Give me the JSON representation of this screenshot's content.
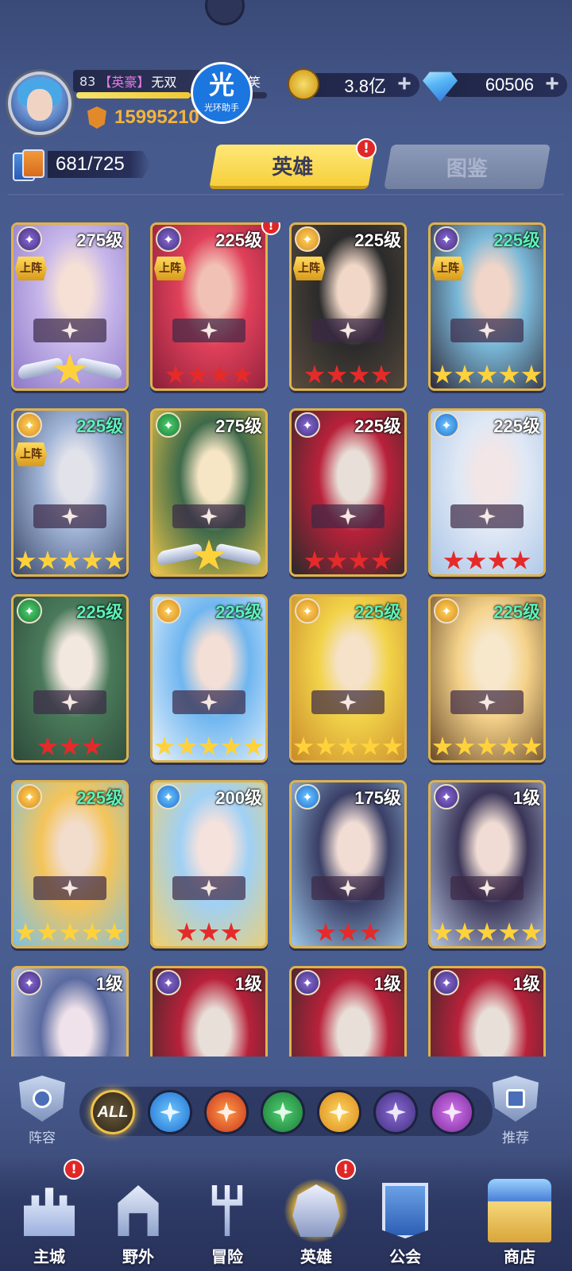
{
  "player": {
    "level": "83",
    "title": "【英豪】",
    "name": "无双",
    "name_suffix": "笑",
    "power": "15995210",
    "exp_fraction": 0.6,
    "helper_badge_char": "光",
    "helper_badge_label": "光环助手"
  },
  "currencies": {
    "gold": "3.8亿",
    "gems": "60506",
    "plus": "+"
  },
  "hero_count": "681/725",
  "tabs": {
    "heroes": "英雄",
    "codex": "图鉴",
    "alert": "!"
  },
  "heroes": [
    {
      "level": "275级",
      "faction": "void",
      "deployed": true,
      "stars": 1,
      "star_color": "wing",
      "border": "gold",
      "alert": false,
      "art": [
        "#c7b7ea",
        "#8e78c9",
        "#f6e0d6"
      ]
    },
    {
      "level": "225级",
      "faction": "void",
      "deployed": true,
      "stars": 4,
      "star_color": "red",
      "border": "gold",
      "alert": true,
      "art": [
        "#e0405a",
        "#8a1f3a",
        "#f2c1b5"
      ]
    },
    {
      "level": "225级",
      "faction": "light",
      "deployed": true,
      "stars": 4,
      "star_color": "red",
      "border": "gold",
      "alert": false,
      "art": [
        "#2b2b2b",
        "#5b4b3e",
        "#f1d7c7"
      ]
    },
    {
      "level": "225级",
      "faction": "void",
      "deployed": true,
      "stars": 5,
      "star_color": "gold",
      "border": "gold",
      "alert": false,
      "art": [
        "#7ab8d8",
        "#2f2a3a",
        "#f0d5c8"
      ],
      "level_color": "green"
    },
    {
      "level": "225级",
      "faction": "light",
      "deployed": true,
      "stars": 5,
      "star_color": "gold",
      "border": "gold",
      "alert": false,
      "art": [
        "#9fb3d6",
        "#3a4766",
        "#e2e2ea"
      ],
      "level_color": "green"
    },
    {
      "level": "275级",
      "faction": "nature",
      "deployed": false,
      "stars": 1,
      "star_color": "wing",
      "border": "gold",
      "alert": false,
      "art": [
        "#3e6a4a",
        "#f0c84a",
        "#f7e6c5"
      ]
    },
    {
      "level": "225级",
      "faction": "void",
      "deployed": false,
      "stars": 4,
      "star_color": "red",
      "border": "gold",
      "alert": false,
      "art": [
        "#b8213a",
        "#2a2a2a",
        "#e8e0d8"
      ]
    },
    {
      "level": "225级",
      "faction": "water",
      "deployed": false,
      "stars": 4,
      "star_color": "red",
      "border": "gold",
      "alert": false,
      "art": [
        "#dfe8f5",
        "#a9c4e6",
        "#f3e6e6"
      ]
    },
    {
      "level": "225级",
      "faction": "nature",
      "deployed": false,
      "stars": 3,
      "star_color": "red",
      "border": "gold",
      "alert": false,
      "art": [
        "#4a7a5a",
        "#2d4a3a",
        "#f3e8e0"
      ],
      "level_color": "green"
    },
    {
      "level": "225级",
      "faction": "light",
      "deployed": false,
      "stars": 5,
      "star_color": "gold",
      "border": "gold",
      "alert": false,
      "art": [
        "#6fb6f0",
        "#e8f2fb",
        "#f3dfd6"
      ],
      "level_color": "green"
    },
    {
      "level": "225级",
      "faction": "light",
      "deployed": false,
      "stars": 5,
      "star_color": "gold",
      "border": "gold",
      "alert": false,
      "art": [
        "#f2d34a",
        "#c98a2a",
        "#f5e2c8"
      ],
      "level_color": "green"
    },
    {
      "level": "225级",
      "faction": "light",
      "deployed": false,
      "stars": 5,
      "star_color": "gold",
      "border": "gold",
      "alert": false,
      "art": [
        "#f4d28a",
        "#6a4a2a",
        "#f7e8cc"
      ],
      "level_color": "green"
    },
    {
      "level": "225级",
      "faction": "light",
      "deployed": false,
      "stars": 5,
      "star_color": "gold",
      "border": "gold",
      "alert": false,
      "art": [
        "#f4c45a",
        "#7ac0e6",
        "#f2dccb"
      ],
      "level_color": "green"
    },
    {
      "level": "200级",
      "faction": "water",
      "deployed": false,
      "stars": 3,
      "star_color": "red",
      "border": "gold",
      "alert": false,
      "art": [
        "#9fd0f5",
        "#f2cf6a",
        "#f6e2dc"
      ]
    },
    {
      "level": "175级",
      "faction": "water",
      "deployed": false,
      "stars": 3,
      "star_color": "red",
      "border": "gold",
      "alert": false,
      "art": [
        "#3a3f66",
        "#9ec8ea",
        "#f2ddd5"
      ]
    },
    {
      "level": "1级",
      "faction": "void",
      "deployed": false,
      "stars": 5,
      "star_color": "gold",
      "border": "gold",
      "alert": false,
      "art": [
        "#3a3558",
        "#b8c6e0",
        "#f0dcd4"
      ]
    },
    {
      "level": "1级",
      "faction": "void",
      "deployed": false,
      "stars": 0,
      "star_color": "gold",
      "border": "gold",
      "alert": false,
      "art": [
        "#5a6aa0",
        "#d6dcef",
        "#efe2ea"
      ]
    },
    {
      "level": "1级",
      "faction": "void",
      "deployed": false,
      "stars": 0,
      "star_color": "red",
      "border": "gold",
      "alert": false,
      "art": [
        "#b8213a",
        "#2a2a2a",
        "#e8e0d8"
      ]
    },
    {
      "level": "1级",
      "faction": "void",
      "deployed": false,
      "stars": 0,
      "star_color": "red",
      "border": "gold",
      "alert": false,
      "art": [
        "#b8213a",
        "#2a2a2a",
        "#e8e0d8"
      ]
    },
    {
      "level": "1级",
      "faction": "void",
      "deployed": false,
      "stars": 0,
      "star_color": "red",
      "border": "gold",
      "alert": false,
      "art": [
        "#b8213a",
        "#2a2a2a",
        "#e8e0d8"
      ]
    }
  ],
  "deploy_label": "上阵",
  "filters": {
    "lineup_label": "阵容",
    "recommend_label": "推荐",
    "all_label": "ALL",
    "factions": [
      "water",
      "fire",
      "nature",
      "light",
      "void",
      "dark"
    ]
  },
  "nav": [
    {
      "label": "主城",
      "icon": "castle-icon",
      "alert": true
    },
    {
      "label": "野外",
      "icon": "gate-icon",
      "alert": false
    },
    {
      "label": "冒险",
      "icon": "trident-icon",
      "alert": false
    },
    {
      "label": "英雄",
      "icon": "helmet-icon",
      "alert": true,
      "active": true
    },
    {
      "label": "公会",
      "icon": "banner-icon",
      "alert": false
    },
    {
      "label": "商店",
      "icon": "shop-icon",
      "alert": false
    }
  ],
  "colors": {
    "tab_active": "#f6cf3b",
    "alert_red": "#e02727",
    "power_orange": "#f4b33c",
    "level_green": "#5cf0b8"
  }
}
